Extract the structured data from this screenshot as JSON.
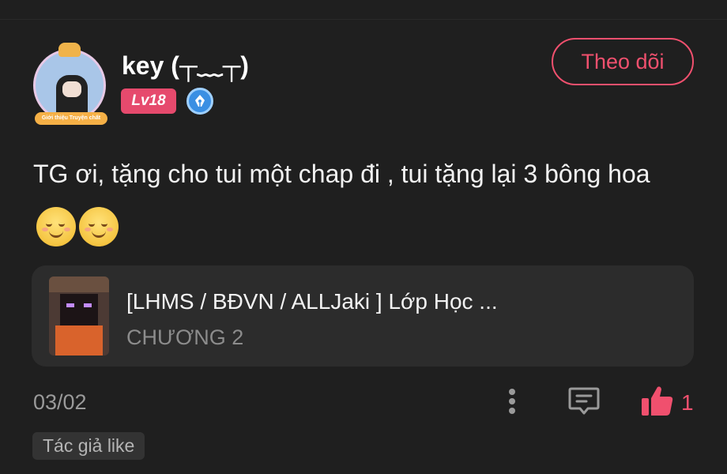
{
  "comment": {
    "avatar_banner": "Giới thiệu Truyện chất",
    "username": "key (┬﹏┬)",
    "level": "Lv18",
    "follow_label": "Theo dõi",
    "text": "TG ơi, tặng cho tui một chap đi , tui tặng lại 3 bông hoa",
    "emojis": [
      "smiling-face-emoji",
      "smiling-face-emoji"
    ],
    "story": {
      "title": "[LHMS / BĐVN / ALLJaki ] Lớp Học ...",
      "chapter": "CHƯƠNG 2"
    },
    "date": "03/02",
    "like_count": "1",
    "author_like_tag": "Tác giả like"
  },
  "colors": {
    "background": "#1f1f1f",
    "accent": "#f0506e",
    "card": "#2c2c2c",
    "level_badge": "#e64a6d",
    "muted_text": "#9a9a9a"
  }
}
